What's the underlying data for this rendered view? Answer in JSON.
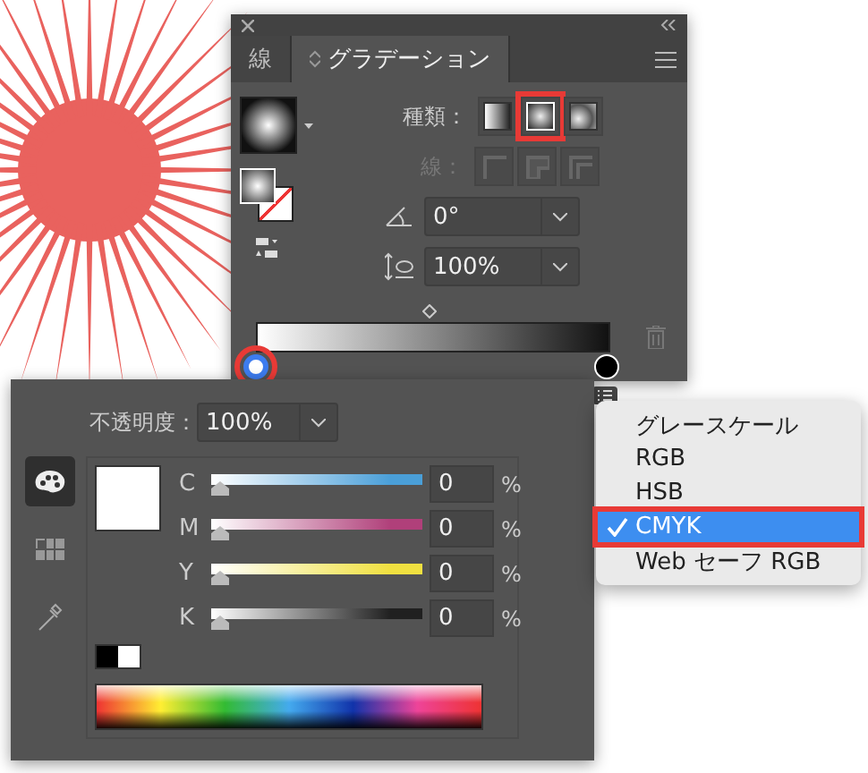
{
  "gradient_panel": {
    "tabs": [
      {
        "label": "線",
        "selected": false
      },
      {
        "label": "グラデーション",
        "selected": true
      }
    ],
    "type_label": "種類：",
    "types": [
      {
        "kind": "linear",
        "selected": false,
        "highlighted": false
      },
      {
        "kind": "radial",
        "selected": true,
        "highlighted": true
      },
      {
        "kind": "freeform",
        "selected": false,
        "highlighted": false
      }
    ],
    "stroke_label": "線：",
    "angle": "0°",
    "aspect": "100%",
    "stops": [
      {
        "kind": "white",
        "selected": true,
        "highlighted": true
      },
      {
        "kind": "black",
        "selected": false,
        "highlighted": false
      }
    ]
  },
  "color_panel": {
    "opacity_label": "不透明度：",
    "opacity": "100%",
    "modes": [
      {
        "kind": "palette",
        "selected": true
      },
      {
        "kind": "swatches",
        "selected": false
      },
      {
        "kind": "eyedropper",
        "selected": false
      }
    ],
    "channels": [
      {
        "name": "C",
        "level": 0,
        "value": "0",
        "unit": "%",
        "color": "#4a9fd8"
      },
      {
        "name": "M",
        "level": 0,
        "value": "0",
        "unit": "%",
        "color": "#b0407a"
      },
      {
        "name": "Y",
        "level": 0,
        "value": "0",
        "unit": "%",
        "color": "#f0e040"
      },
      {
        "name": "K",
        "level": 0,
        "value": "0",
        "unit": "%",
        "color": "#202020"
      }
    ]
  },
  "menu": {
    "items": [
      {
        "label": "グレースケール",
        "selected": false,
        "highlighted": false
      },
      {
        "label": "RGB",
        "selected": false,
        "highlighted": false
      },
      {
        "label": "HSB",
        "selected": false,
        "highlighted": false
      },
      {
        "label": "CMYK",
        "selected": true,
        "highlighted": true
      },
      {
        "label": "Web セーフ RGB",
        "selected": false,
        "highlighted": false
      }
    ]
  }
}
